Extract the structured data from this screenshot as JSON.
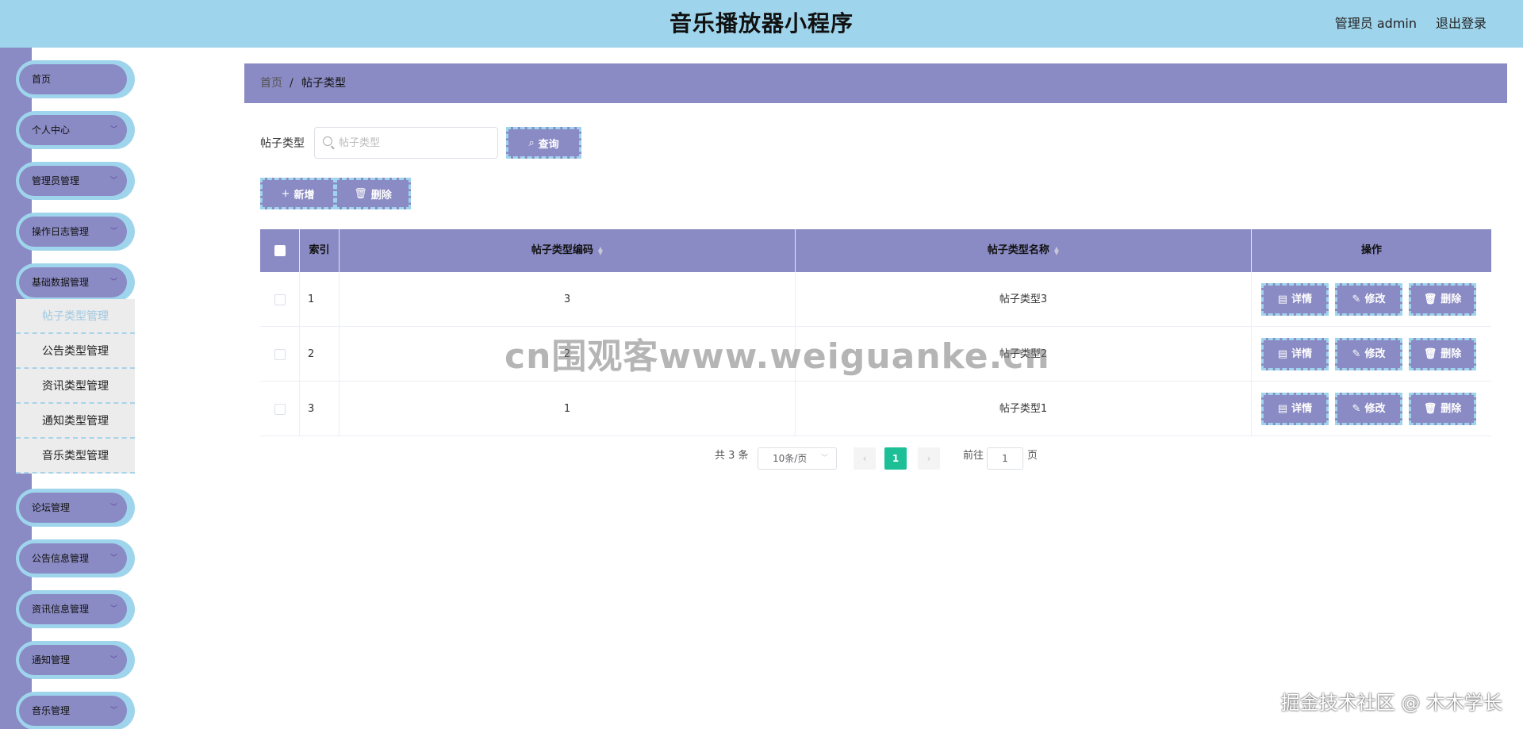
{
  "header": {
    "title": "音乐播放器小程序",
    "user": "管理员 admin",
    "logout": "退出登录"
  },
  "sidebar": {
    "items": [
      {
        "label": "首页",
        "has_children": false
      },
      {
        "label": "个人中心",
        "has_children": true
      },
      {
        "label": "管理员管理",
        "has_children": true
      },
      {
        "label": "操作日志管理",
        "has_children": true
      },
      {
        "label": "基础数据管理",
        "has_children": true,
        "expanded": true
      },
      {
        "label": "论坛管理",
        "has_children": true
      },
      {
        "label": "公告信息管理",
        "has_children": true
      },
      {
        "label": "资讯信息管理",
        "has_children": true
      },
      {
        "label": "通知管理",
        "has_children": true
      },
      {
        "label": "音乐管理",
        "has_children": true
      }
    ],
    "submenu": [
      {
        "label": "帖子类型管理",
        "active": true
      },
      {
        "label": "公告类型管理",
        "active": false
      },
      {
        "label": "资讯类型管理",
        "active": false
      },
      {
        "label": "通知类型管理",
        "active": false
      },
      {
        "label": "音乐类型管理",
        "active": false
      }
    ]
  },
  "breadcrumb": {
    "home": "首页",
    "separator": "/",
    "current": "帖子类型"
  },
  "search": {
    "label": "帖子类型",
    "placeholder": "帖子类型",
    "value": "",
    "button": "查询"
  },
  "actions": {
    "add": "新增",
    "delete": "删除"
  },
  "table": {
    "columns": [
      "索引",
      "帖子类型编码",
      "帖子类型名称",
      "操作"
    ],
    "rows": [
      {
        "index": "1",
        "code": "3",
        "name": "帖子类型3"
      },
      {
        "index": "2",
        "code": "2",
        "name": "帖子类型2"
      },
      {
        "index": "3",
        "code": "1",
        "name": "帖子类型1"
      }
    ],
    "row_actions": {
      "detail": "详情",
      "edit": "修改",
      "delete": "删除"
    }
  },
  "pagination": {
    "total": "共 3 条",
    "page_size": "10条/页",
    "pages": [
      "1"
    ],
    "current": "1",
    "goto_label": "前往",
    "goto_value": "1",
    "goto_suffix": "页"
  },
  "watermark": "cn围观客www.weiguanke.cn",
  "corner_mark": "掘金技术社区 @ 木木学长",
  "colors": {
    "header_bg": "#9fd5ec",
    "accent": "#8a8ac4",
    "active_page": "#1dbf96"
  },
  "icons": {
    "search": "search-icon",
    "add": "plus-icon",
    "delete": "trash-icon",
    "detail": "document-icon",
    "edit": "pencil-icon",
    "expand": "chevron-down-icon"
  }
}
